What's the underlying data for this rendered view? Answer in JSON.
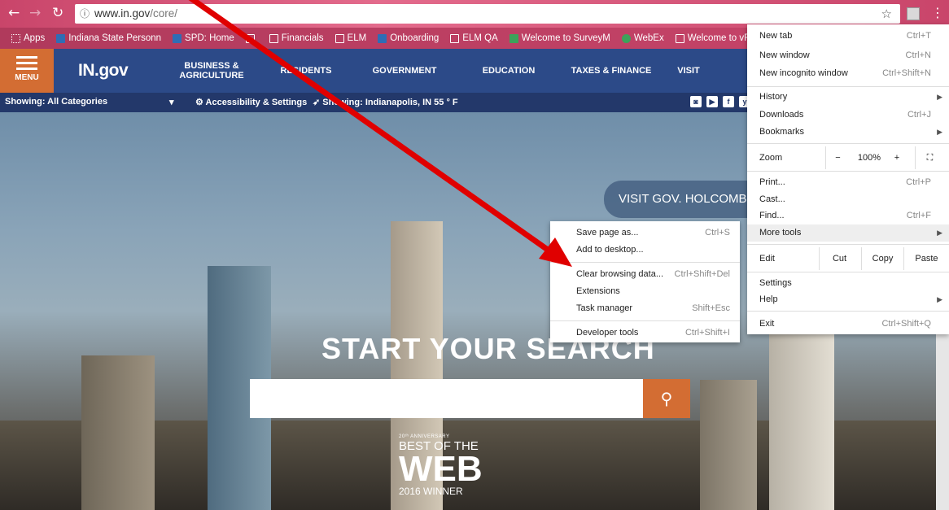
{
  "browser": {
    "url_host": "www.in.gov",
    "url_path": "/core/",
    "star": "☆",
    "kebab": "⋮"
  },
  "bookmarks": [
    {
      "label": "Apps",
      "icon": "apps-grid-icon"
    },
    {
      "label": "Indiana State Personn",
      "icon": "s-logo-icon"
    },
    {
      "label": "SPD: Home",
      "icon": "bookmark-blue-icon"
    },
    {
      "label": "",
      "icon": "page-icon"
    },
    {
      "label": "Financials",
      "icon": "page-icon"
    },
    {
      "label": "ELM",
      "icon": "page-icon"
    },
    {
      "label": "Onboarding",
      "icon": "bookmark-blue-icon"
    },
    {
      "label": "ELM QA",
      "icon": "page-icon"
    },
    {
      "label": "Welcome to SurveyM",
      "icon": "survey-icon"
    },
    {
      "label": "WebEx",
      "icon": "webex-icon"
    },
    {
      "label": "Welcome to vFire",
      "icon": "page-icon"
    }
  ],
  "site": {
    "menu_label": "MENU",
    "logo": "IN.gov",
    "nav": [
      "BUSINESS & AGRICULTURE",
      "RESIDENTS",
      "GOVERNMENT",
      "EDUCATION",
      "TAXES & FINANCE",
      "VISIT"
    ],
    "showing": "Showing: All Categories",
    "dropdown_arrow": "▾",
    "accessibility": "⚙ Accessibility & Settings",
    "location": "➶ Showing: Indianapolis, IN 55 ° F",
    "social": [
      "◙",
      "▶",
      "f",
      "y"
    ]
  },
  "hero": {
    "banner": "VISIT GOV. HOLCOMB'S",
    "title": "START YOUR SEARCH",
    "search_placeholder": "",
    "search_icon": "⚲",
    "award_line1": "20ᵗʰ ANNIVERSARY",
    "award_line2": "BEST OF THE",
    "award_line3": "WEB",
    "award_line4": "2016 WINNER"
  },
  "chrome_menu": {
    "new_tab": "New tab",
    "new_tab_sc": "Ctrl+T",
    "new_window": "New window",
    "new_window_sc": "Ctrl+N",
    "incognito": "New incognito window",
    "incognito_sc": "Ctrl+Shift+N",
    "history": "History",
    "downloads": "Downloads",
    "downloads_sc": "Ctrl+J",
    "bookmarks": "Bookmarks",
    "zoom": "Zoom",
    "zoom_minus": "−",
    "zoom_value": "100%",
    "zoom_plus": "+",
    "fullscreen": "⛶",
    "print": "Print...",
    "print_sc": "Ctrl+P",
    "cast": "Cast...",
    "find": "Find...",
    "find_sc": "Ctrl+F",
    "more_tools": "More tools",
    "edit": "Edit",
    "cut": "Cut",
    "copy": "Copy",
    "paste": "Paste",
    "settings": "Settings",
    "help": "Help",
    "exit": "Exit",
    "exit_sc": "Ctrl+Shift+Q",
    "arrow": "▶"
  },
  "more_tools": {
    "save_page": "Save page as...",
    "save_page_sc": "Ctrl+S",
    "add_desktop": "Add to desktop...",
    "clear_data": "Clear browsing data...",
    "clear_data_sc": "Ctrl+Shift+Del",
    "extensions": "Extensions",
    "task_manager": "Task manager",
    "task_manager_sc": "Shift+Esc",
    "dev_tools": "Developer tools",
    "dev_tools_sc": "Ctrl+Shift+I"
  },
  "colors": {
    "chrome_pink": "#c9456a",
    "site_blue": "#2c4a88",
    "accent_orange": "#d36d33",
    "annotation_red": "#e00000"
  }
}
